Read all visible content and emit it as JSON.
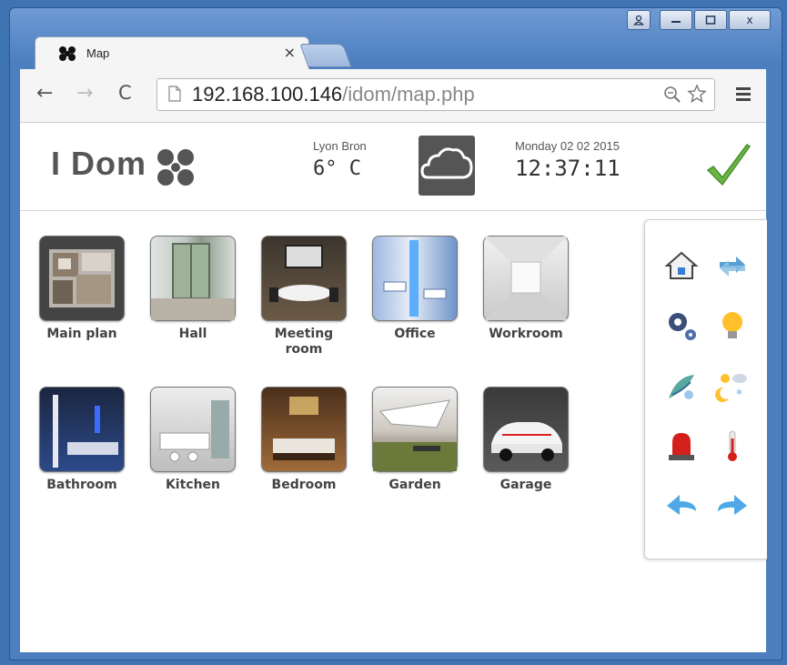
{
  "browser": {
    "tab_title": "Map",
    "tab_close": "×",
    "url_host": "192.168.100.146",
    "url_path": "/idom/map.php",
    "window_controls": [
      "user-icon",
      "minimize-icon",
      "maximize-icon",
      "close-icon"
    ],
    "close_glyph": "x"
  },
  "header": {
    "logo": "I Dom",
    "location": "Lyon Bron",
    "temperature": "6° C",
    "weather_icon": "cloud-icon",
    "date": "Monday 02 02 2015",
    "time": "12:37:11",
    "status_icon": "check-icon"
  },
  "rooms": [
    {
      "label": "Main plan",
      "icon": "floor-plan"
    },
    {
      "label": "Hall",
      "icon": "hall"
    },
    {
      "label": "Meeting room",
      "icon": "meeting-room"
    },
    {
      "label": "Office",
      "icon": "office"
    },
    {
      "label": "Workroom",
      "icon": "workroom"
    },
    {
      "label": "Bathroom",
      "icon": "bathroom"
    },
    {
      "label": "Kitchen",
      "icon": "kitchen"
    },
    {
      "label": "Bedroom",
      "icon": "bedroom"
    },
    {
      "label": "Garden",
      "icon": "garden"
    },
    {
      "label": "Garage",
      "icon": "garage"
    }
  ],
  "sidebar": {
    "buttons": [
      "home-icon",
      "refresh-icon",
      "settings-icon",
      "light-bulb-icon",
      "scenes-icon",
      "weather-icon",
      "alarm-icon",
      "thermometer-icon",
      "back-arrow-icon",
      "forward-arrow-icon"
    ]
  },
  "colors": {
    "frame": "#4d7ec0",
    "check": "#6ab543",
    "arrow": "#4fa9e6"
  }
}
